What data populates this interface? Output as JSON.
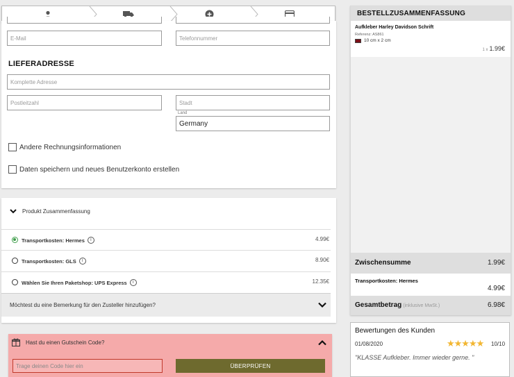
{
  "steps": [
    {
      "icon": "user-icon"
    },
    {
      "icon": "truck-icon"
    },
    {
      "icon": "plus-circle-icon"
    },
    {
      "icon": "credit-card-icon"
    }
  ],
  "form": {
    "email_placeholder": "E-Mail",
    "phone_placeholder": "Telefonnummer",
    "delivery_title": "LIEFERADRESSE",
    "address_placeholder": "Komplette Adresse",
    "zip_placeholder": "Postleitzahl",
    "city_placeholder": "Stadt",
    "country_label": "Land",
    "country_value": "Germany",
    "billing_checkbox": "Andere Rechnungsinformationen",
    "save_checkbox": "Daten speichern und neues Benutzerkonto erstellen"
  },
  "shipping": {
    "summary_toggle": "Produkt Zusammenfassung",
    "options": [
      {
        "label": "Transportkosten: Hermes",
        "price": "4.99€",
        "selected": true
      },
      {
        "label": "Transportkosten: GLS",
        "price": "8.90€",
        "selected": false
      },
      {
        "label": "Wählen Sie Ihren Paketshop: UPS Express",
        "price": "12.35€",
        "selected": false
      }
    ],
    "remark": "Möchtest du eine Bemerkung für den Zusteller hinzufügen?"
  },
  "voucher": {
    "title": "Hast du einen Gutschein Code?",
    "placeholder": "Trage deinen Code hier ein",
    "button": "ÜBERPRÜFEN"
  },
  "summary": {
    "title": "BESTELLZUSAMMENFASSUNG",
    "product": {
      "name": "Aufkleber Harley Davidson Schrift",
      "reference": "Referenz: AS861",
      "size": "10 cm x 2 cm",
      "swatch_color": "#7b0e16",
      "qty": "1 x",
      "price": "1.99€"
    },
    "subtotal_label": "Zwischensumme",
    "subtotal_value": "1.99€",
    "shipping_label": "Transportkosten: Hermes",
    "shipping_value": "4.99€",
    "total_label": "Gesamtbetrag",
    "total_note": "(inklusive MwSt.)",
    "total_value": "6.98€"
  },
  "reviews": {
    "title": "Bewertungen des Kunden",
    "date": "01/08/2020",
    "stars": "★★★★★",
    "score": "10/10",
    "text": "\"KLASSE Aufkleber. Immer wieder gerne. \""
  }
}
